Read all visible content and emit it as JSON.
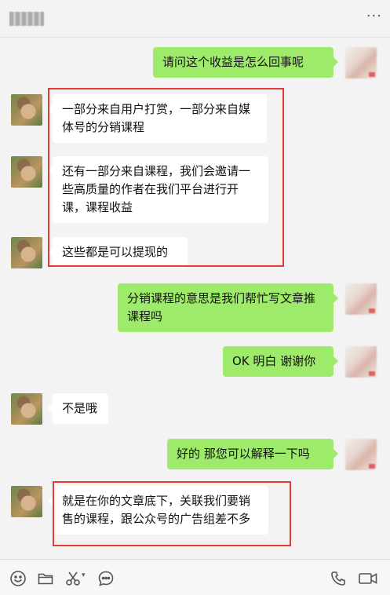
{
  "header": {
    "more_icon": "more-icon",
    "more_glyph": "···"
  },
  "messages": [
    {
      "from": "me",
      "text": "请问这个收益是怎么回事呢"
    },
    {
      "from": "other",
      "text": "一部分来自用户打赏，一部分来自媒体号的分销课程"
    },
    {
      "from": "other",
      "text": "还有一部分来自课程，我们会邀请一些高质量的作者在我们平台进行开课，课程收益"
    },
    {
      "from": "other",
      "text": "这些都是可以提现的"
    },
    {
      "from": "me",
      "text": "分销课程的意思是我们帮忙写文章推课程吗"
    },
    {
      "from": "me",
      "text": "OK 明白 谢谢你"
    },
    {
      "from": "other",
      "text": "不是哦"
    },
    {
      "from": "me",
      "text": "好的 那您可以解释一下吗"
    },
    {
      "from": "other",
      "text": "就是在你的文章底下，关联我们要销售的课程，跟公众号的广告组差不多"
    }
  ],
  "toolbar": {
    "icons": [
      "emoji-icon",
      "folder-icon",
      "scissors-icon",
      "chat-bubble-icon",
      "phone-icon",
      "video-call-icon"
    ],
    "scissors_dropdown": "▾"
  },
  "colors": {
    "me_bubble": "#9eea6a",
    "other_bubble": "#ffffff",
    "highlight": "#e53a36",
    "background": "#f3f3f3"
  }
}
